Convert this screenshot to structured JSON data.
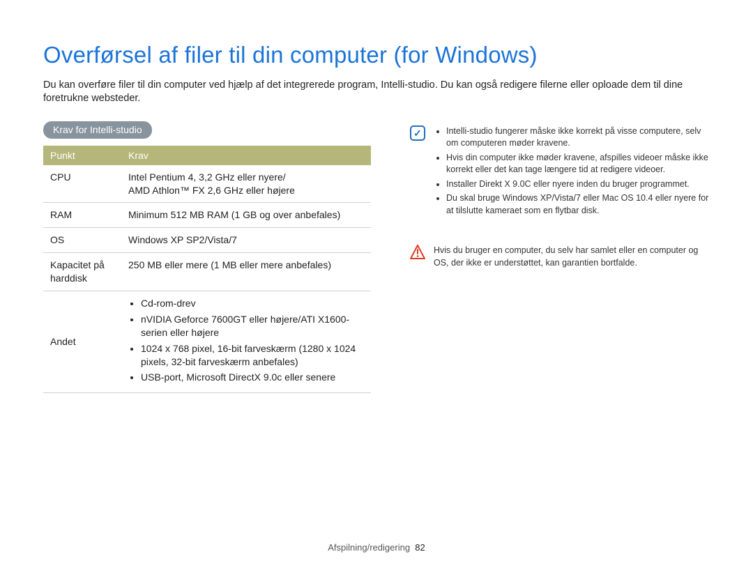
{
  "title": "Overførsel af filer til din computer (for Windows)",
  "intro": "Du kan overføre filer til din computer ved hjælp af det integrerede program, Intelli-studio. Du kan også redigere filerne eller oploade dem til dine foretrukne websteder.",
  "section_heading": "Krav for Intelli-studio",
  "table": {
    "head_col1": "Punkt",
    "head_col2": "Krav",
    "rows": {
      "cpu": {
        "label": "CPU",
        "value": "Intel Pentium 4, 3,2 GHz eller nyere/\nAMD Athlon™ FX 2,6 GHz eller højere"
      },
      "ram": {
        "label": "RAM",
        "value": "Minimum 512 MB RAM (1 GB og over anbefales)"
      },
      "os": {
        "label": "OS",
        "value": "Windows XP SP2/Vista/7"
      },
      "disk": {
        "label": "Kapacitet på harddisk",
        "value": "250 MB eller mere (1 MB eller mere anbefales)"
      },
      "other_label": "Andet",
      "other_items": {
        "a": "Cd-rom-drev",
        "b": "nVIDIA Geforce 7600GT eller højere/ATI X1600-serien eller højere",
        "c": "1024 x 768 pixel, 16-bit farveskærm (1280 x 1024 pixels, 32-bit farveskærm anbefales)",
        "d": "USB-port, Microsoft DirectX 9.0c eller senere"
      }
    }
  },
  "notes": {
    "a": "Intelli-studio fungerer måske ikke korrekt på visse computere, selv om computeren møder kravene.",
    "b": "Hvis din computer ikke møder kravene, afspilles videoer måske ikke korrekt eller det kan tage længere tid at redigere videoer.",
    "c": "Installer Direkt X 9.0C eller nyere inden du bruger programmet.",
    "d": "Du skal bruge Windows XP/Vista/7 eller Mac OS 10.4 eller nyere for at tilslutte kameraet som en flytbar disk."
  },
  "warning": "Hvis du bruger en computer, du selv har samlet eller en computer og OS, der ikke er understøttet, kan garantien bortfalde.",
  "footer": {
    "section": "Afspilning/redigering",
    "page": "82"
  }
}
